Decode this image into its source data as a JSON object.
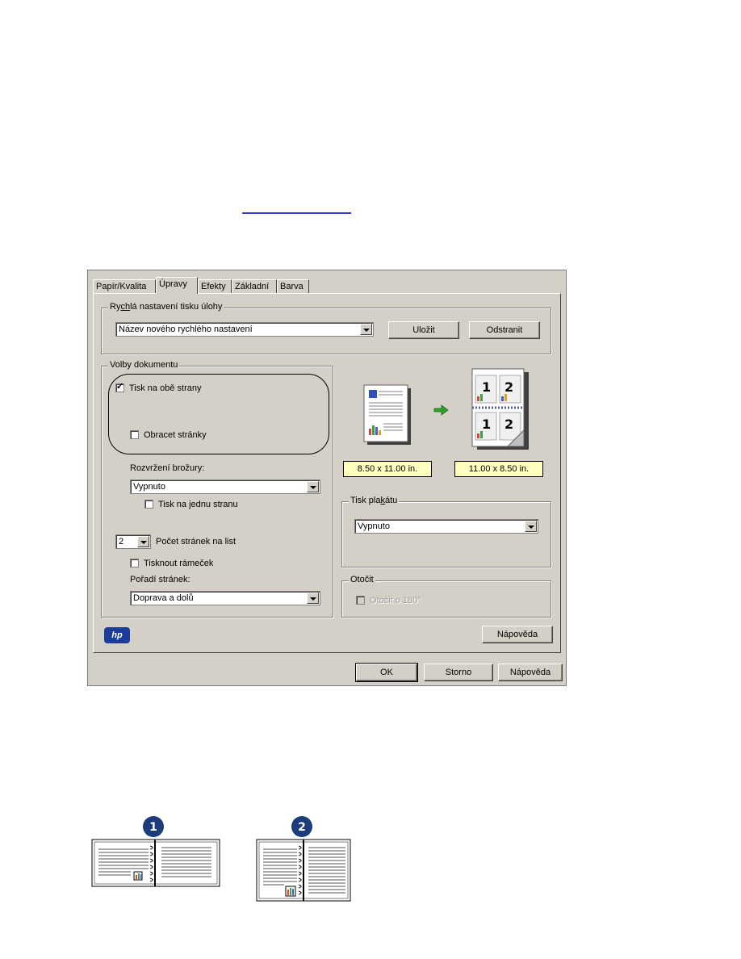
{
  "tabs": [
    "Papír/Kvalita",
    "Úpravy",
    "Efekty",
    "Základní",
    "Barva"
  ],
  "active_tab": "Úpravy",
  "quick_settings": {
    "title": "Rychlá nastavení tisku úlohy",
    "value": "Název nového rychlého nastavení",
    "save_label": "Uložit",
    "delete_label": "Odstranit"
  },
  "doc_options": {
    "title": "Volby dokumentu",
    "duplex_label": "Tisk na obě strany",
    "duplex_checked": true,
    "flip_label": "Obracet stránky",
    "flip_checked": false,
    "booklet_label": "Rozvržení brožury:",
    "booklet_value": "Vypnuto",
    "one_side_label": "Tisk na jednu stranu",
    "pages_per_sheet_value": "2",
    "pages_per_sheet_label": "Počet stránek na list",
    "border_label": "Tisknout rámeček",
    "page_order_label": "Pořadí stránek:",
    "page_order_value": "Doprava a dolů"
  },
  "preview": {
    "size_from": "8.50 x 11.00 in.",
    "size_to": "11.00 x 8.50 in."
  },
  "poster": {
    "title": "Tisk plakátu",
    "value": "Vypnuto"
  },
  "rotate": {
    "title": "Otočit",
    "label": "Otočit o 180°",
    "checked": false
  },
  "help_inner_label": "Nápověda",
  "footer": {
    "ok_label": "OK",
    "cancel_label": "Storno",
    "help_label": "Nápověda"
  },
  "logo_text": "hp",
  "callouts": [
    "1",
    "2"
  ],
  "colors": {
    "dialog_bg": "#d4d0c8",
    "size_box_bg": "#ffffc0",
    "callout": "#1c3c7c",
    "arrow": "#2ea02e"
  }
}
